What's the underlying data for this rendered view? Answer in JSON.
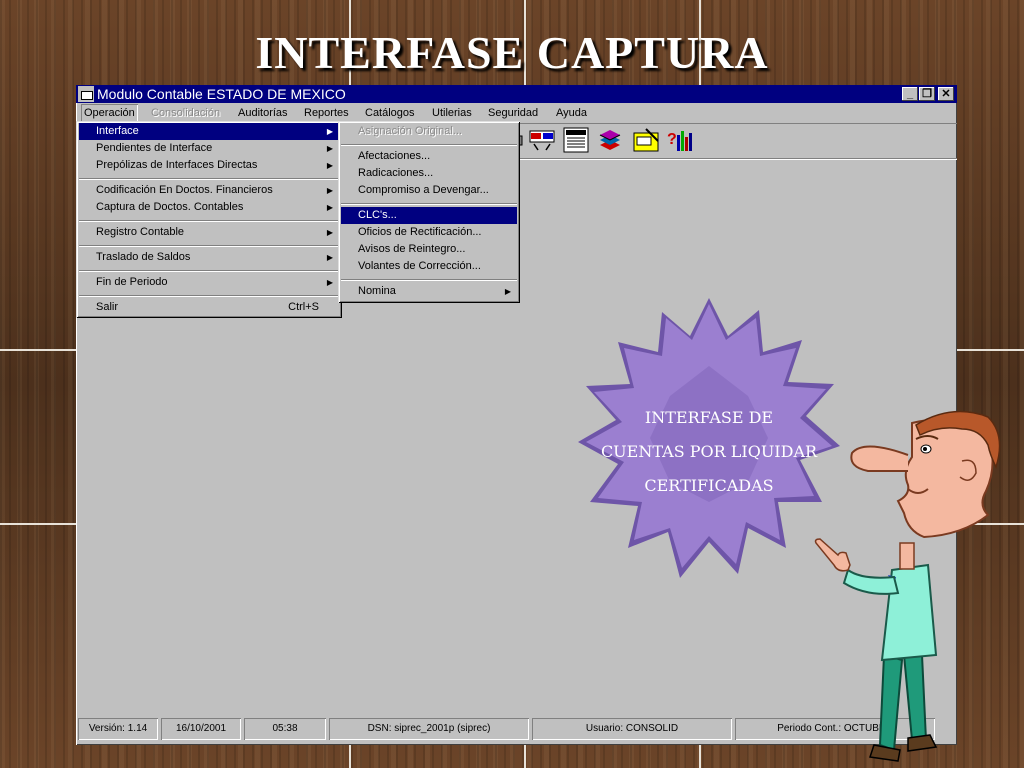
{
  "slide": {
    "title": "INTERFASE CAPTURA"
  },
  "window": {
    "title": "Modulo Contable ESTADO DE MEXICO",
    "controls": {
      "minimize": "_",
      "restore": "❐",
      "close": "✕"
    }
  },
  "menubar": {
    "items": [
      {
        "label": "Operación",
        "state": "open"
      },
      {
        "label": "Consolidación",
        "state": "disabled"
      },
      {
        "label": "Auditorías",
        "state": "normal"
      },
      {
        "label": "Reportes",
        "state": "normal"
      },
      {
        "label": "Catálogos",
        "state": "normal"
      },
      {
        "label": "Utilerias",
        "state": "normal"
      },
      {
        "label": "Seguridad",
        "state": "normal"
      },
      {
        "label": "Ayuda",
        "state": "normal"
      }
    ]
  },
  "operacion_menu": {
    "items": [
      {
        "label": "Interface",
        "submenu": true,
        "selected": true
      },
      {
        "label": "Pendientes de Interface",
        "submenu": true
      },
      {
        "label": "Prepólizas de Interfaces Directas",
        "submenu": true
      },
      {
        "label": "Codificación En Doctos. Financieros",
        "submenu": true
      },
      {
        "label": "Captura de Doctos. Contables",
        "submenu": true
      },
      {
        "label": "Registro Contable",
        "submenu": true
      },
      {
        "label": "Traslado de Saldos",
        "submenu": true
      },
      {
        "label": "Fin de Periodo",
        "submenu": true
      },
      {
        "label": "Salir",
        "accelerator": "Ctrl+S"
      }
    ]
  },
  "interface_submenu": {
    "items": [
      {
        "label": "Asignación Original...",
        "disabled": true
      },
      {
        "label": "Afectaciones..."
      },
      {
        "label": "Radicaciones..."
      },
      {
        "label": "Compromiso a Devengar..."
      },
      {
        "label": "CLC's...",
        "selected": true
      },
      {
        "label": "Oficios de Rectificación..."
      },
      {
        "label": "Avisos de Reintegro..."
      },
      {
        "label": "Volantes de Corrección..."
      },
      {
        "label": "Nomina",
        "submenu": true
      }
    ]
  },
  "toolbar": {
    "icons": [
      "printer-icon",
      "report-icon",
      "document-icon",
      "books-icon",
      "chart-edit-icon",
      "help-chart-icon"
    ]
  },
  "statusbar": {
    "version": "Versión: 1.14",
    "date": "16/10/2001",
    "time": "05:38",
    "dsn": "DSN: siprec_2001p (siprec)",
    "user": "Usuario: CONSOLID",
    "period": "Periodo Cont.: OCTUBRE"
  },
  "callout": {
    "lines": [
      "INTERFASE DE",
      "CUENTAS POR LIQUIDAR",
      "CERTIFICADAS"
    ],
    "colors": {
      "star": "#9b7fd0",
      "star_dark": "#6e55a8",
      "text": "#ffffff"
    }
  },
  "colors": {
    "title_bar": "#000080",
    "selection": "#000080",
    "window_face": "#c0c0c0"
  }
}
